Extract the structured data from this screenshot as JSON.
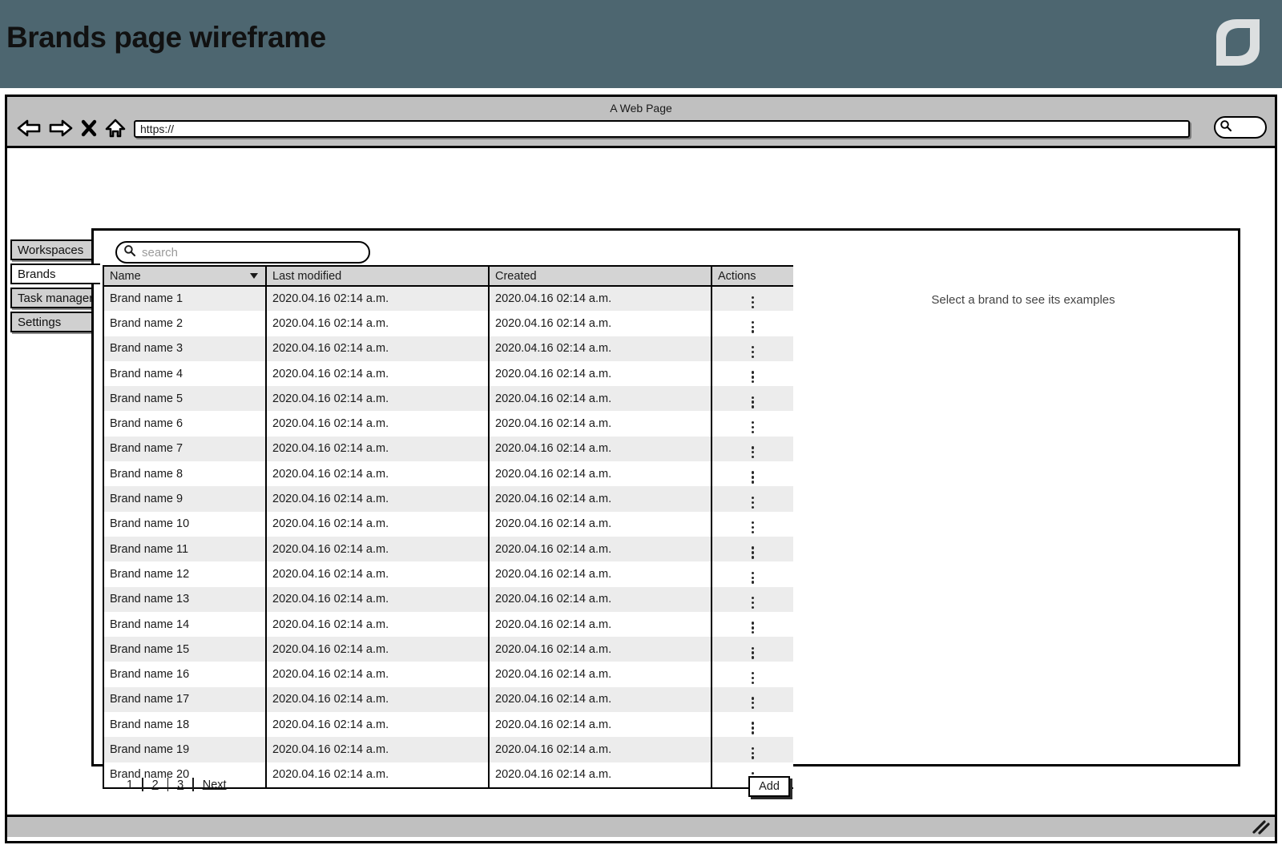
{
  "banner": {
    "title": "Brands page wireframe",
    "background_color": "#4d6670",
    "logo_name": "leaf-logo"
  },
  "browser": {
    "window_title": "A Web Page",
    "url_value": "https://",
    "url_placeholder": "https://",
    "nav": {
      "back_label": "Back",
      "forward_label": "Forward",
      "stop_label": "Stop",
      "home_label": "Home"
    },
    "search_placeholder": ""
  },
  "sidebar": {
    "items": [
      {
        "label": "Workspaces",
        "active": false
      },
      {
        "label": "Brands",
        "active": true
      },
      {
        "label": "Task manager",
        "active": false
      },
      {
        "label": "Settings",
        "active": false
      }
    ]
  },
  "search": {
    "value": "",
    "placeholder": "search"
  },
  "table": {
    "columns": [
      "Name",
      "Last modified",
      "Created",
      "Actions"
    ],
    "sort_column": "Name",
    "sort_direction": "desc",
    "rows": [
      {
        "name": "Brand name 1",
        "last_modified": "2020.04.16 02:14 a.m.",
        "created": "2020.04.16 02:14 a.m."
      },
      {
        "name": "Brand name 2",
        "last_modified": "2020.04.16 02:14 a.m.",
        "created": "2020.04.16 02:14 a.m."
      },
      {
        "name": "Brand name 3",
        "last_modified": "2020.04.16 02:14 a.m.",
        "created": "2020.04.16 02:14 a.m."
      },
      {
        "name": "Brand name 4",
        "last_modified": "2020.04.16 02:14 a.m.",
        "created": "2020.04.16 02:14 a.m."
      },
      {
        "name": "Brand name 5",
        "last_modified": "2020.04.16 02:14 a.m.",
        "created": "2020.04.16 02:14 a.m."
      },
      {
        "name": "Brand name 6",
        "last_modified": "2020.04.16 02:14 a.m.",
        "created": "2020.04.16 02:14 a.m."
      },
      {
        "name": "Brand name 7",
        "last_modified": "2020.04.16 02:14 a.m.",
        "created": "2020.04.16 02:14 a.m."
      },
      {
        "name": "Brand name 8",
        "last_modified": "2020.04.16 02:14 a.m.",
        "created": "2020.04.16 02:14 a.m."
      },
      {
        "name": "Brand name 9",
        "last_modified": "2020.04.16 02:14 a.m.",
        "created": "2020.04.16 02:14 a.m."
      },
      {
        "name": "Brand name 10",
        "last_modified": "2020.04.16 02:14 a.m.",
        "created": "2020.04.16 02:14 a.m."
      },
      {
        "name": "Brand name 11",
        "last_modified": "2020.04.16 02:14 a.m.",
        "created": "2020.04.16 02:14 a.m."
      },
      {
        "name": "Brand name 12",
        "last_modified": "2020.04.16 02:14 a.m.",
        "created": "2020.04.16 02:14 a.m."
      },
      {
        "name": "Brand name 13",
        "last_modified": "2020.04.16 02:14 a.m.",
        "created": "2020.04.16 02:14 a.m."
      },
      {
        "name": "Brand name 14",
        "last_modified": "2020.04.16 02:14 a.m.",
        "created": "2020.04.16 02:14 a.m."
      },
      {
        "name": "Brand name 15",
        "last_modified": "2020.04.16 02:14 a.m.",
        "created": "2020.04.16 02:14 a.m."
      },
      {
        "name": "Brand name 16",
        "last_modified": "2020.04.16 02:14 a.m.",
        "created": "2020.04.16 02:14 a.m."
      },
      {
        "name": "Brand name 17",
        "last_modified": "2020.04.16 02:14 a.m.",
        "created": "2020.04.16 02:14 a.m."
      },
      {
        "name": "Brand name 18",
        "last_modified": "2020.04.16 02:14 a.m.",
        "created": "2020.04.16 02:14 a.m."
      },
      {
        "name": "Brand name 19",
        "last_modified": "2020.04.16 02:14 a.m.",
        "created": "2020.04.16 02:14 a.m."
      },
      {
        "name": "Brand name 20",
        "last_modified": "2020.04.16 02:14 a.m.",
        "created": "2020.04.16 02:14 a.m."
      }
    ]
  },
  "pagination": {
    "pages": [
      "1",
      "2",
      "3"
    ],
    "current_page": "1",
    "next_label": "Next"
  },
  "actions": {
    "add_label": "Add"
  },
  "detail_panel": {
    "placeholder_text": "Select a brand to see its examples"
  }
}
